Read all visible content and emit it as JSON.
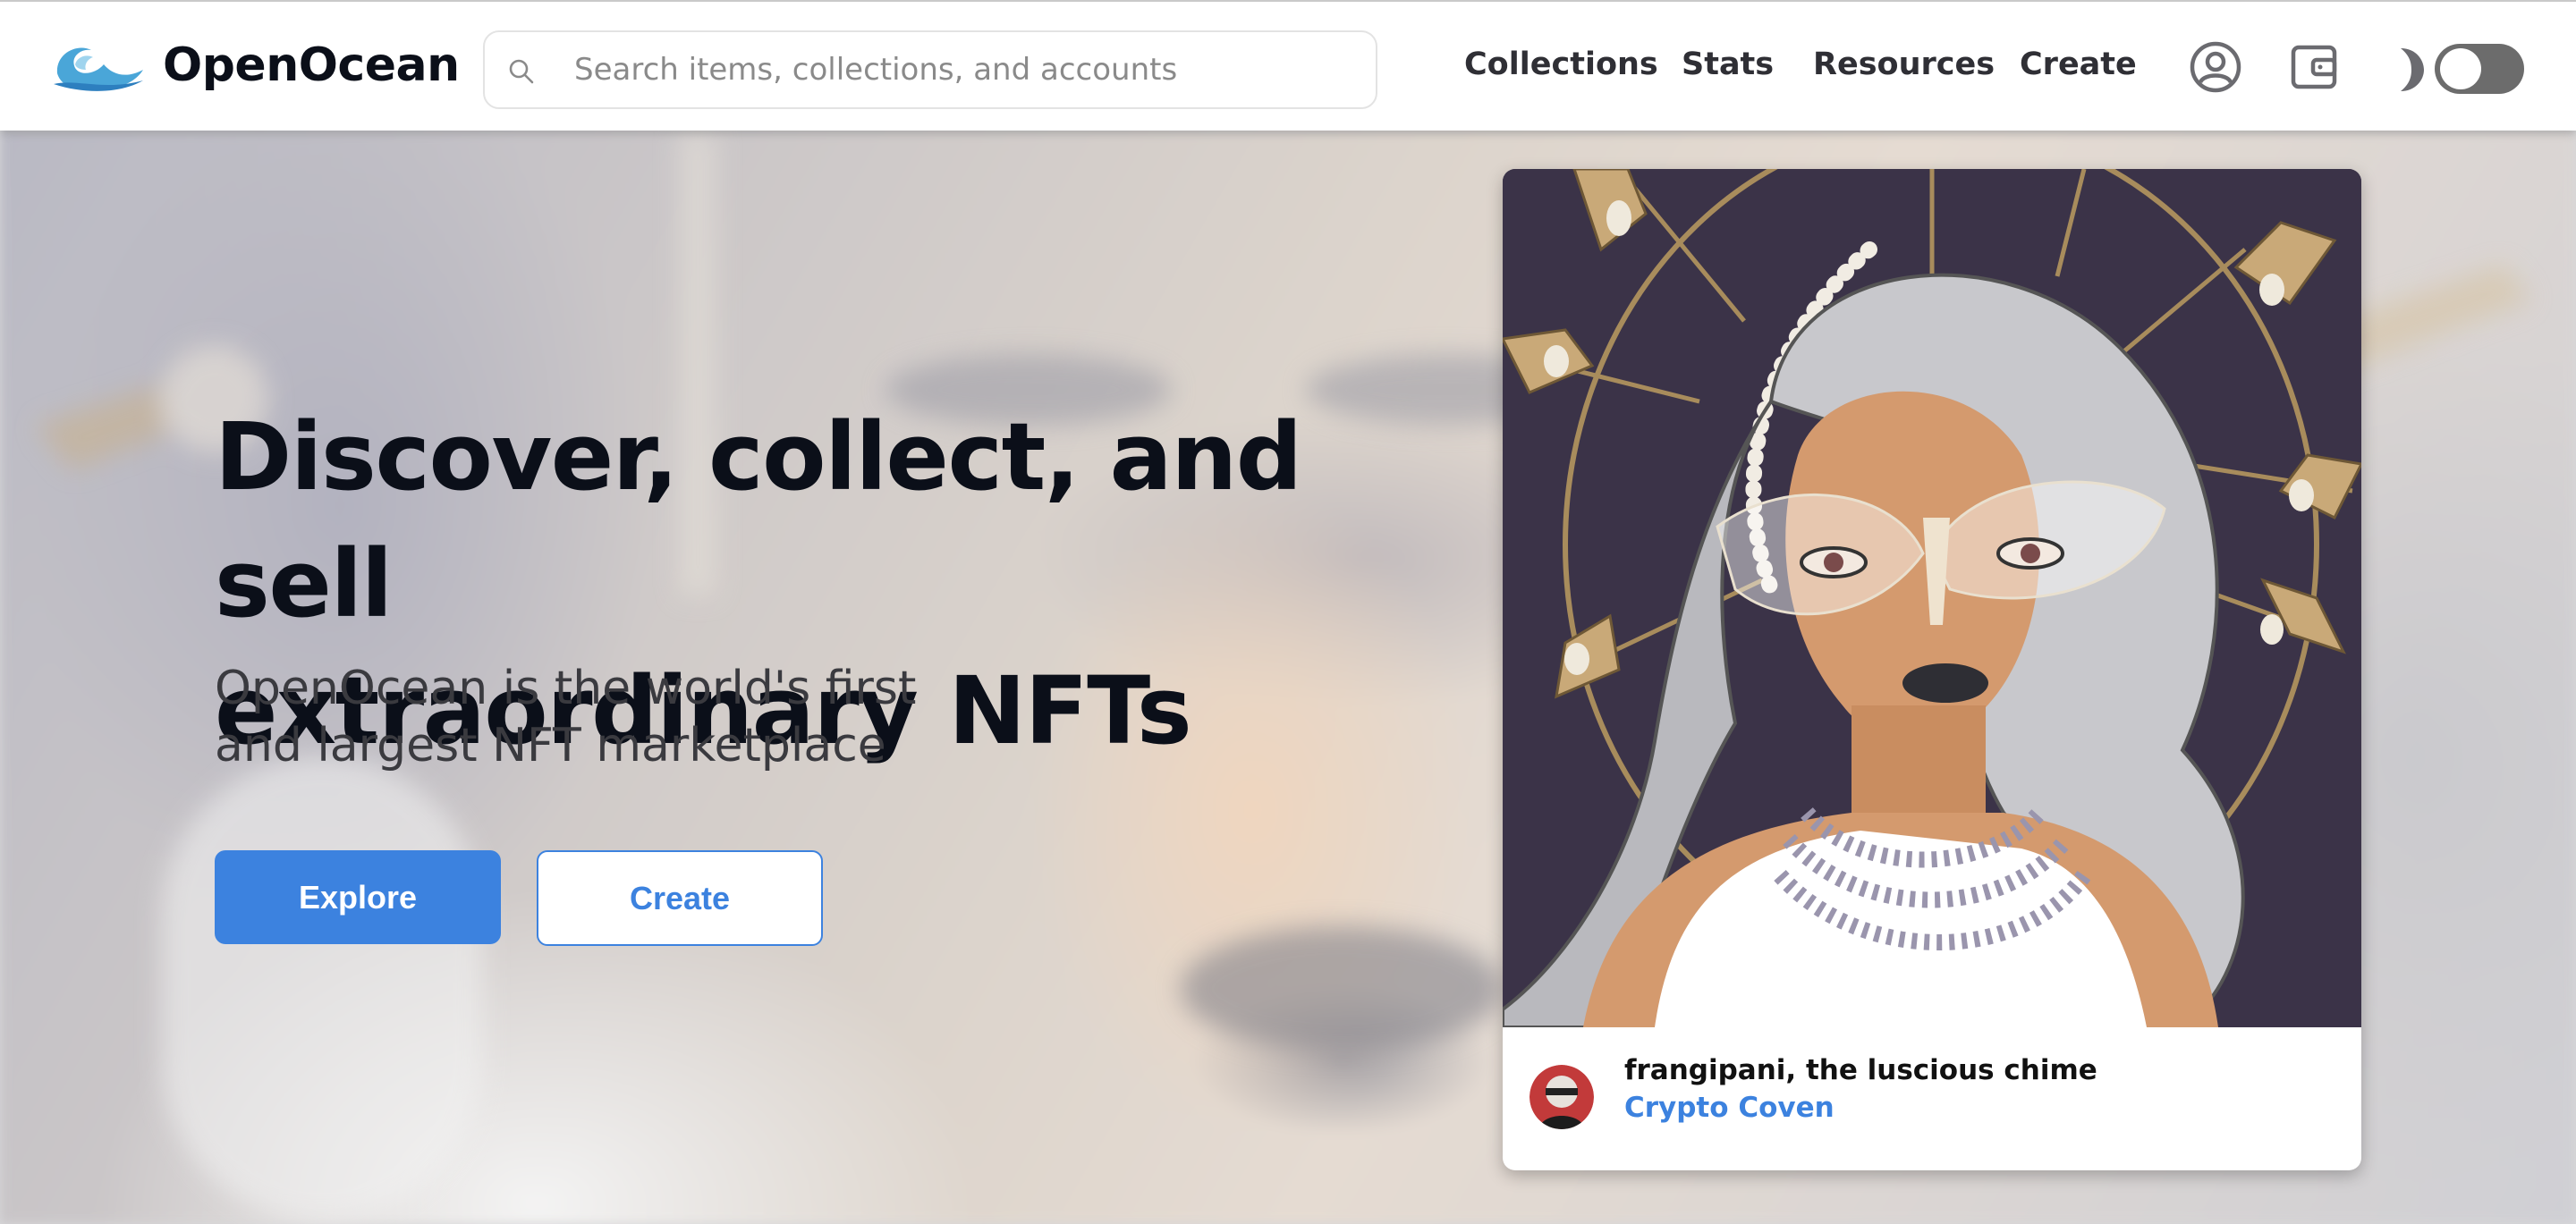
{
  "brand": {
    "name": "OpenOcean",
    "logo_icon": "wave-logo-icon",
    "accent_color": "#3c82df"
  },
  "search": {
    "placeholder": "Search items, collections, and accounts",
    "value": "",
    "icon": "search-icon"
  },
  "nav": {
    "items": [
      {
        "label": "Collections"
      },
      {
        "label": "Stats"
      },
      {
        "label": "Resources"
      },
      {
        "label": "Create"
      }
    ],
    "profile_icon": "user-circle-icon",
    "wallet_icon": "wallet-icon",
    "theme_icon": "moon-icon",
    "theme_toggle_on": false
  },
  "hero": {
    "title_lines": [
      "Discover, collect, and sell",
      "extraordinary NFTs"
    ],
    "subtitle_lines": [
      "OpenOcean is the world's first",
      "and largest NFT marketplace"
    ],
    "explore_label": "Explore",
    "create_label": "Create"
  },
  "featured": {
    "name": "frangipani, the luscious chime",
    "collection": "Crypto Coven"
  }
}
